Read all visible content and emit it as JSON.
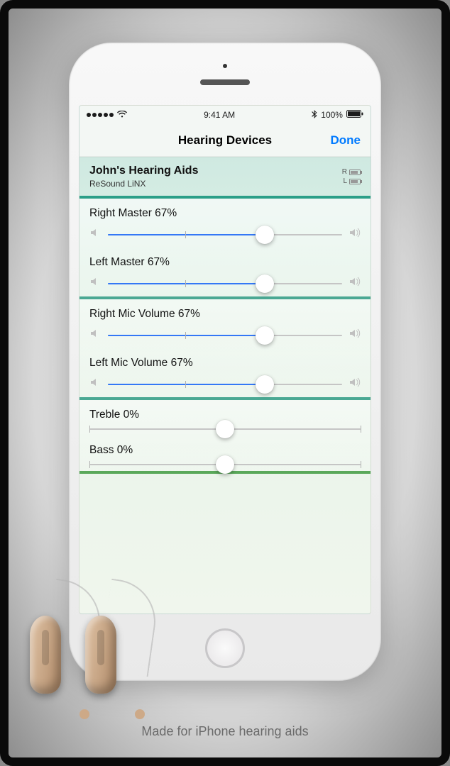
{
  "status": {
    "time": "9:41 AM",
    "batt_pct": "100%"
  },
  "nav": {
    "title": "Hearing Devices",
    "done": "Done"
  },
  "device": {
    "name": "John's Hearing Aids",
    "model": "ReSound LiNX",
    "r_label": "R",
    "l_label": "L"
  },
  "sliders": {
    "right_master": {
      "label": "Right Master  67%",
      "pct": 67,
      "mode": "vol"
    },
    "left_master": {
      "label": "Left Master  67%",
      "pct": 67,
      "mode": "vol"
    },
    "right_mic": {
      "label": "Right Mic Volume  67%",
      "pct": 67,
      "mode": "vol"
    },
    "left_mic": {
      "label": "Left Mic Volume  67%",
      "pct": 67,
      "mode": "vol"
    },
    "treble": {
      "label": "Treble 0%",
      "pct": 50,
      "mode": "eq"
    },
    "bass": {
      "label": "Bass 0%",
      "pct": 50,
      "mode": "eq"
    }
  },
  "caption": "Made for iPhone hearing aids"
}
